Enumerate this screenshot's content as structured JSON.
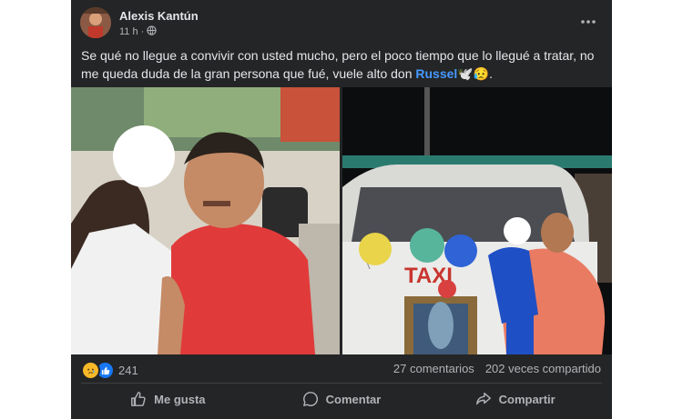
{
  "post": {
    "author": "Alexis Kantún",
    "time": "11 h",
    "separator": "·",
    "text_before": "Se qué no llegue a convivir con usted mucho, pero el poco tiempo que lo llegué a tratar, no me queda duda de la gran persona que fué, vuele alto don ",
    "mention": "Russel",
    "text_after": "🕊️😥."
  },
  "photos": {
    "left": {
      "description_icon": "photo-man-with-child"
    },
    "right": {
      "van_text": "TAXI",
      "description_icon": "photo-man-with-balloons-van"
    }
  },
  "stats": {
    "reaction_icons": [
      "sad-reaction-icon",
      "like-reaction-icon"
    ],
    "reaction_count": "241",
    "comments": "27 comentarios",
    "shares": "202 veces compartido"
  },
  "actions": {
    "like": "Me gusta",
    "comment": "Comentar",
    "share": "Compartir"
  },
  "colors": {
    "card_bg": "#242526",
    "text": "#e4e6eb",
    "secondary": "#b0b3b8",
    "mention": "#4599ff",
    "like_blue": "#1877f2",
    "sad_yellow": "#f7b928"
  }
}
